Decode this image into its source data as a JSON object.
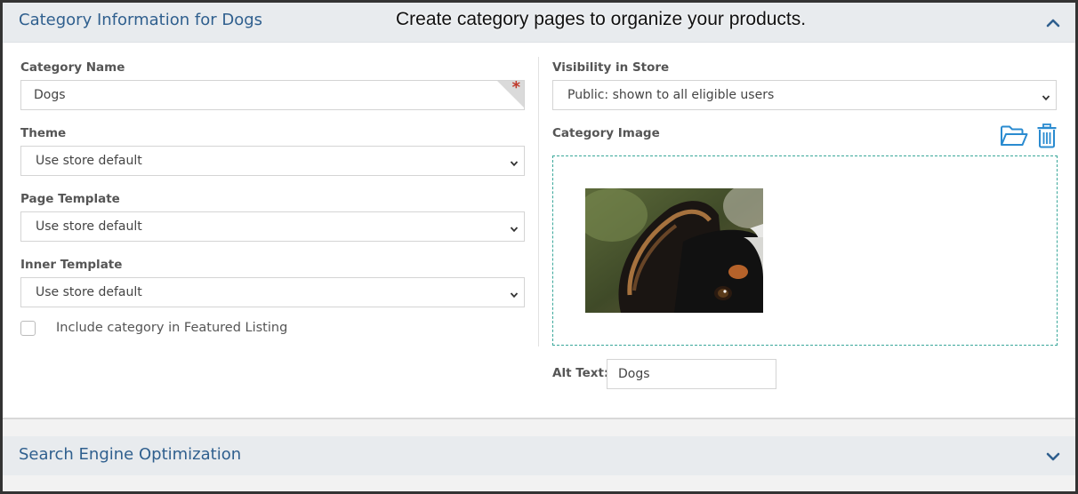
{
  "caption": "Create category pages to organize your products.",
  "category_panel": {
    "title": "Category Information for Dogs",
    "collapse_icon": "chevron-up-icon"
  },
  "left_column": {
    "category_name": {
      "label": "Category Name",
      "value": "Dogs",
      "required_mark": "*"
    },
    "theme": {
      "label": "Theme",
      "value": "Use store default"
    },
    "page_template": {
      "label": "Page Template",
      "value": "Use store default"
    },
    "inner_template": {
      "label": "Inner Template",
      "value": "Use store default"
    },
    "featured": {
      "label": "Include category in Featured Listing",
      "checked": false
    }
  },
  "right_column": {
    "visibility": {
      "label": "Visibility in Store",
      "value": "Public: shown to all eligible users"
    },
    "category_image": {
      "label": "Category Image",
      "browse_icon": "folder-open-icon",
      "delete_icon": "trash-icon"
    },
    "alt_text": {
      "label": "Alt Text:",
      "value": "Dogs"
    }
  },
  "seo_panel": {
    "title": "Search Engine Optimization",
    "expand_icon": "chevron-down-icon"
  },
  "colors": {
    "header_text": "#2f5f8e",
    "accent_icon": "#2a8bd0",
    "dropzone_border": "#3aa79a",
    "required": "#c0392b"
  }
}
